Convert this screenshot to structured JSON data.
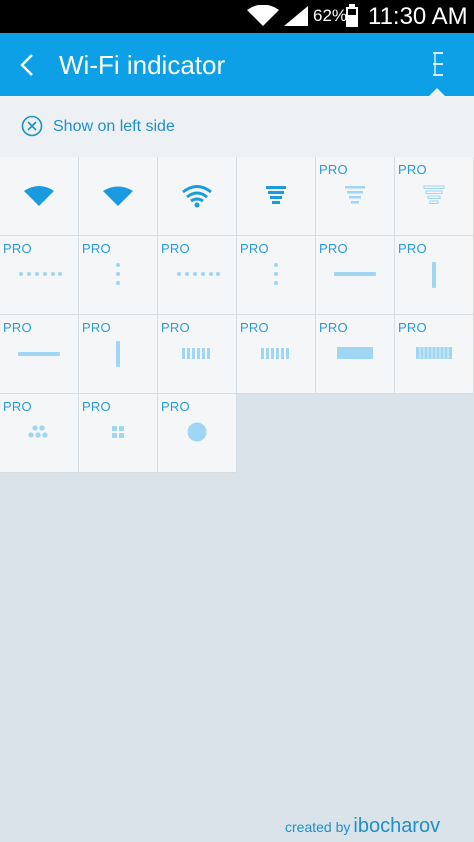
{
  "status_bar": {
    "battery_percent": "62%",
    "time": "11:30 AM",
    "icons": [
      "wifi-icon",
      "signal-icon",
      "battery-icon"
    ]
  },
  "app_bar": {
    "title": "Wi-Fi indicator",
    "back_icon": "back-arrow-icon",
    "menu_icon": "overflow-menu-icon"
  },
  "option": {
    "label": "Show on left side",
    "icon": "circle-x-icon"
  },
  "indicators": [
    {
      "icon": "wifi-fan-solid",
      "pro": ""
    },
    {
      "icon": "wifi-fan-solid-small",
      "pro": ""
    },
    {
      "icon": "wifi-arcs",
      "pro": ""
    },
    {
      "icon": "wifi-funnel-bars",
      "pro": ""
    },
    {
      "icon": "wifi-funnel-light",
      "pro": "PRO"
    },
    {
      "icon": "wifi-funnel-outline",
      "pro": "PRO"
    },
    {
      "icon": "dots-horizontal",
      "pro": "PRO"
    },
    {
      "icon": "dots-vertical",
      "pro": "PRO"
    },
    {
      "icon": "dots-horizontal-2",
      "pro": "PRO"
    },
    {
      "icon": "dots-vertical-2",
      "pro": "PRO"
    },
    {
      "icon": "bar-horizontal",
      "pro": "PRO"
    },
    {
      "icon": "bar-vertical",
      "pro": "PRO"
    },
    {
      "icon": "bar-horizontal-2",
      "pro": "PRO"
    },
    {
      "icon": "bar-vertical-2",
      "pro": "PRO"
    },
    {
      "icon": "segments",
      "pro": "PRO"
    },
    {
      "icon": "segments-2",
      "pro": "PRO"
    },
    {
      "icon": "block-bar",
      "pro": "PRO"
    },
    {
      "icon": "block-bar-striped",
      "pro": "PRO"
    },
    {
      "icon": "dots-triangle",
      "pro": "PRO"
    },
    {
      "icon": "squares-grid",
      "pro": "PRO"
    },
    {
      "icon": "circle",
      "pro": "PRO"
    }
  ],
  "footer": {
    "prefix": "created by",
    "author": "ibocharov"
  },
  "colors": {
    "accent": "#0ea0e6",
    "icon_blue": "#1a9be0",
    "icon_light": "#9fd6f3",
    "background": "#dbe3ea"
  }
}
